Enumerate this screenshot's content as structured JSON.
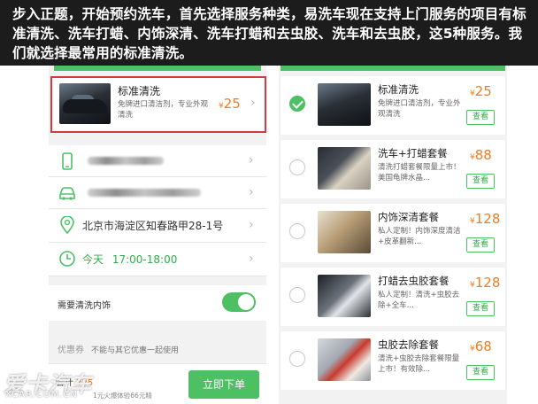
{
  "caption": "步入正题，开始预约洗车，首先选择服务种类，易洗车现在支持上门服务的项目有标准清洗、洗车打蜡、内饰深清、洗车打蜡和去虫胶、洗车和去虫胶，这5种服务。我们就选择最常用的标准清洗。",
  "left": {
    "service": {
      "title": "标准清洗",
      "desc": "免牌进口清洁剂，专业外观清洗",
      "currency": "¥",
      "price": "25"
    },
    "address": "北京市海淀区知春路甲28-1号",
    "time_label": "今天",
    "time_range": "17:00-18:00",
    "interior_label": "需要清洗内饰",
    "coupon_label": "优惠券",
    "coupon_hint": "不能与其它优惠一起使用",
    "total_label": "合计",
    "total_value": "¥25",
    "total_sub": "1元火爆体验66元精",
    "order_button": "立即下单"
  },
  "right": {
    "packages": [
      {
        "title": "标准清洗",
        "desc": "免牌进口清洁剂，专业外观清洗",
        "price": "25",
        "view": "查看",
        "selected": true
      },
      {
        "title": "洗车+打蜡套餐",
        "desc": "清洗打蜡套餐限量上市！美国龟牌水晶...",
        "price": "88",
        "view": "查看",
        "selected": false
      },
      {
        "title": "内饰深清套餐",
        "desc": "私人定制！内饰深度清洁+皮革翻新...",
        "price": "128",
        "view": "查看",
        "selected": false
      },
      {
        "title": "打蜡去虫胶套餐",
        "desc": "私人定制！清洗+虫胶去除+全车...",
        "price": "128",
        "view": "查看",
        "selected": false
      },
      {
        "title": "虫胶去除套餐",
        "desc": "清洗+虫胶去除套餐限量上市！有效除...",
        "price": "68",
        "view": "查看",
        "selected": false
      }
    ],
    "currency": "¥"
  },
  "watermark": {
    "main": "爱卡汽车",
    "sub": "XCAR.COM.CN"
  },
  "colors": {
    "accent": "#4cc063",
    "price": "#f07c22",
    "highlight_border": "#d63b3b"
  }
}
